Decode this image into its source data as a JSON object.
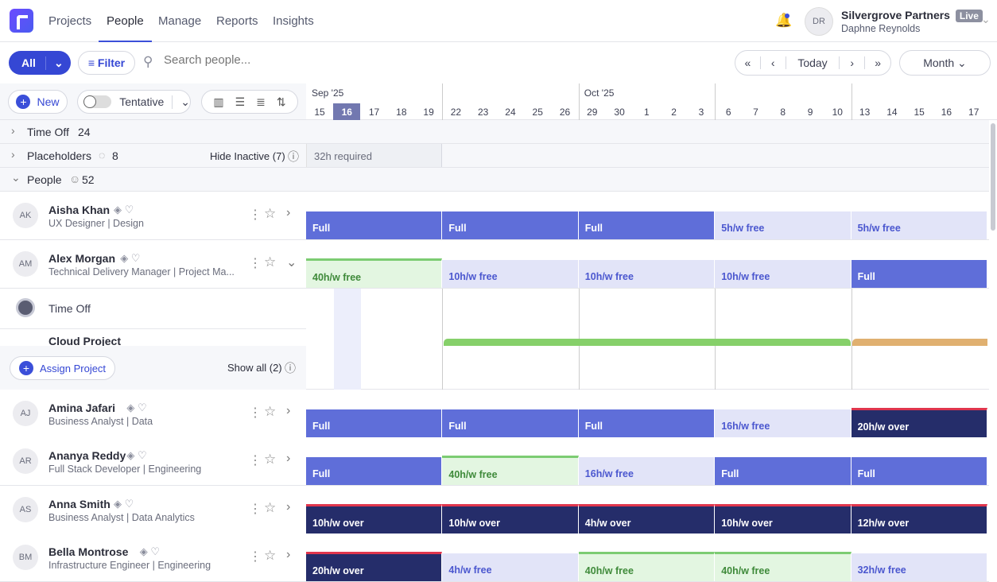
{
  "nav": {
    "items": [
      "Projects",
      "People",
      "Manage",
      "Reports",
      "Insights"
    ],
    "active": "People"
  },
  "account": {
    "initials": "DR",
    "org": "Silvergrove Partners",
    "badge": "Live",
    "user": "Daphne Reynolds"
  },
  "toolbar": {
    "all": "All",
    "filter": "Filter",
    "search_placeholder": "Search people...",
    "today": "Today",
    "view": "Month"
  },
  "controls": {
    "new": "New",
    "tentative": "Tentative"
  },
  "timeline": {
    "months": [
      {
        "label": "Sep '25",
        "week": 0
      },
      {
        "label": "Oct '25",
        "week": 2
      }
    ],
    "days": [
      "15",
      "16",
      "17",
      "18",
      "19",
      "22",
      "23",
      "24",
      "25",
      "26",
      "29",
      "30",
      "1",
      "2",
      "3",
      "6",
      "7",
      "8",
      "9",
      "10",
      "13",
      "14",
      "15",
      "16",
      "17"
    ],
    "today_index": 1
  },
  "groups": {
    "timeoff": {
      "label": "Time Off",
      "count": "24"
    },
    "placeholders": {
      "label": "Placeholders",
      "count": "8",
      "hide": "Hide Inactive (7)",
      "required": "32h required"
    },
    "people": {
      "label": "People",
      "count": "52"
    }
  },
  "expanded": {
    "timeoff": "Time Off",
    "project": "Cloud Project",
    "assign": "Assign Project",
    "showall": "Show all (2)"
  },
  "people": [
    {
      "initials": "AK",
      "name": "Aisha Khan",
      "role": "UX Designer | Design",
      "weeks": [
        [
          "full",
          "Full"
        ],
        [
          "full",
          "Full"
        ],
        [
          "full",
          "Full"
        ],
        [
          "free",
          "5h/w free"
        ],
        [
          "free",
          "5h/w free"
        ]
      ]
    },
    {
      "initials": "AM",
      "name": "Alex Morgan",
      "role": "Technical Delivery Manager | Project Ma...",
      "weeks": [
        [
          "green",
          "40h/w free"
        ],
        [
          "free",
          "10h/w free"
        ],
        [
          "free",
          "10h/w free"
        ],
        [
          "free",
          "10h/w free"
        ],
        [
          "full",
          "Full"
        ]
      ]
    },
    {
      "initials": "AJ",
      "name": "Amina Jafari",
      "role": "Business Analyst | Data",
      "weeks": [
        [
          "full",
          "Full"
        ],
        [
          "full",
          "Full"
        ],
        [
          "full",
          "Full"
        ],
        [
          "free",
          "16h/w free"
        ],
        [
          "over",
          "20h/w over"
        ]
      ]
    },
    {
      "initials": "AR",
      "name": "Ananya Reddy",
      "role": "Full Stack Developer | Engineering",
      "weeks": [
        [
          "full",
          "Full"
        ],
        [
          "green",
          "40h/w free"
        ],
        [
          "free",
          "16h/w free"
        ],
        [
          "full",
          "Full"
        ],
        [
          "full",
          "Full"
        ]
      ]
    },
    {
      "initials": "AS",
      "name": "Anna Smith",
      "role": "Business Analyst | Data Analytics",
      "weeks": [
        [
          "over",
          "10h/w over"
        ],
        [
          "over",
          "10h/w over"
        ],
        [
          "over",
          "4h/w over"
        ],
        [
          "over",
          "10h/w over"
        ],
        [
          "over",
          "12h/w over"
        ]
      ]
    },
    {
      "initials": "BM",
      "name": "Bella Montrose",
      "role": "Infrastructure Engineer | Engineering",
      "weeks": [
        [
          "over",
          "20h/w over"
        ],
        [
          "free",
          "4h/w free"
        ],
        [
          "green",
          "40h/w free"
        ],
        [
          "green",
          "40h/w free"
        ],
        [
          "free",
          "32h/w free"
        ]
      ]
    }
  ]
}
